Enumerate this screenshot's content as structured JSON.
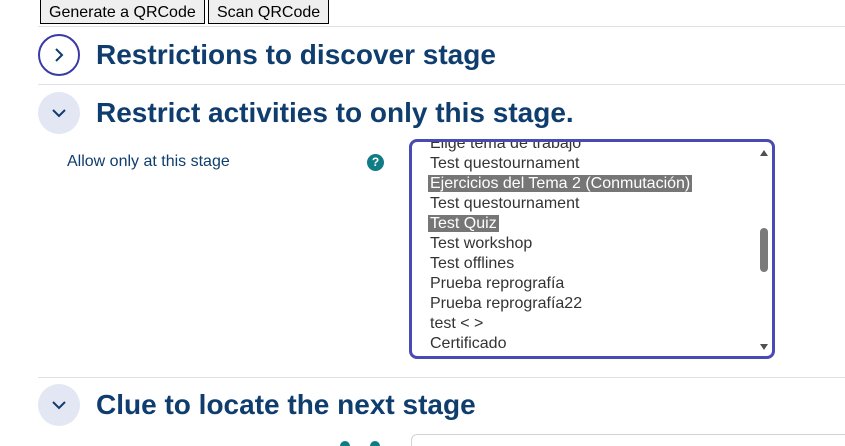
{
  "toolbar": {
    "generate_label": "Generate a QRCode",
    "scan_label": "Scan QRCode"
  },
  "sections": [
    {
      "title": "Restrictions to discover stage",
      "state": "collapsed"
    },
    {
      "title": "Restrict activities to only this stage.",
      "state": "expanded"
    },
    {
      "title": "Clue to locate the next stage",
      "state": "expanded"
    }
  ],
  "field": {
    "label": "Allow only at this stage",
    "help_symbol": "?"
  },
  "activities": {
    "options": [
      {
        "label": "Elige tema de trabajo",
        "selected": false
      },
      {
        "label": "Test questournament",
        "selected": false
      },
      {
        "label": "Ejercicios del Tema 2 (Conmutación)",
        "selected": true
      },
      {
        "label": "Test questournament",
        "selected": false
      },
      {
        "label": "Test Quiz",
        "selected": true
      },
      {
        "label": "Test workshop",
        "selected": false
      },
      {
        "label": "Test offlines",
        "selected": false
      },
      {
        "label": "Prueba reprografía",
        "selected": false
      },
      {
        "label": "Prueba reprografía22",
        "selected": false
      },
      {
        "label": "test < >",
        "selected": false
      },
      {
        "label": "Certificado",
        "selected": false
      }
    ]
  },
  "colors": {
    "heading": "#0f3d6e",
    "focus_border": "#4a4ab4",
    "selected_bg": "#767676",
    "help_icon": "#0f7c86"
  }
}
